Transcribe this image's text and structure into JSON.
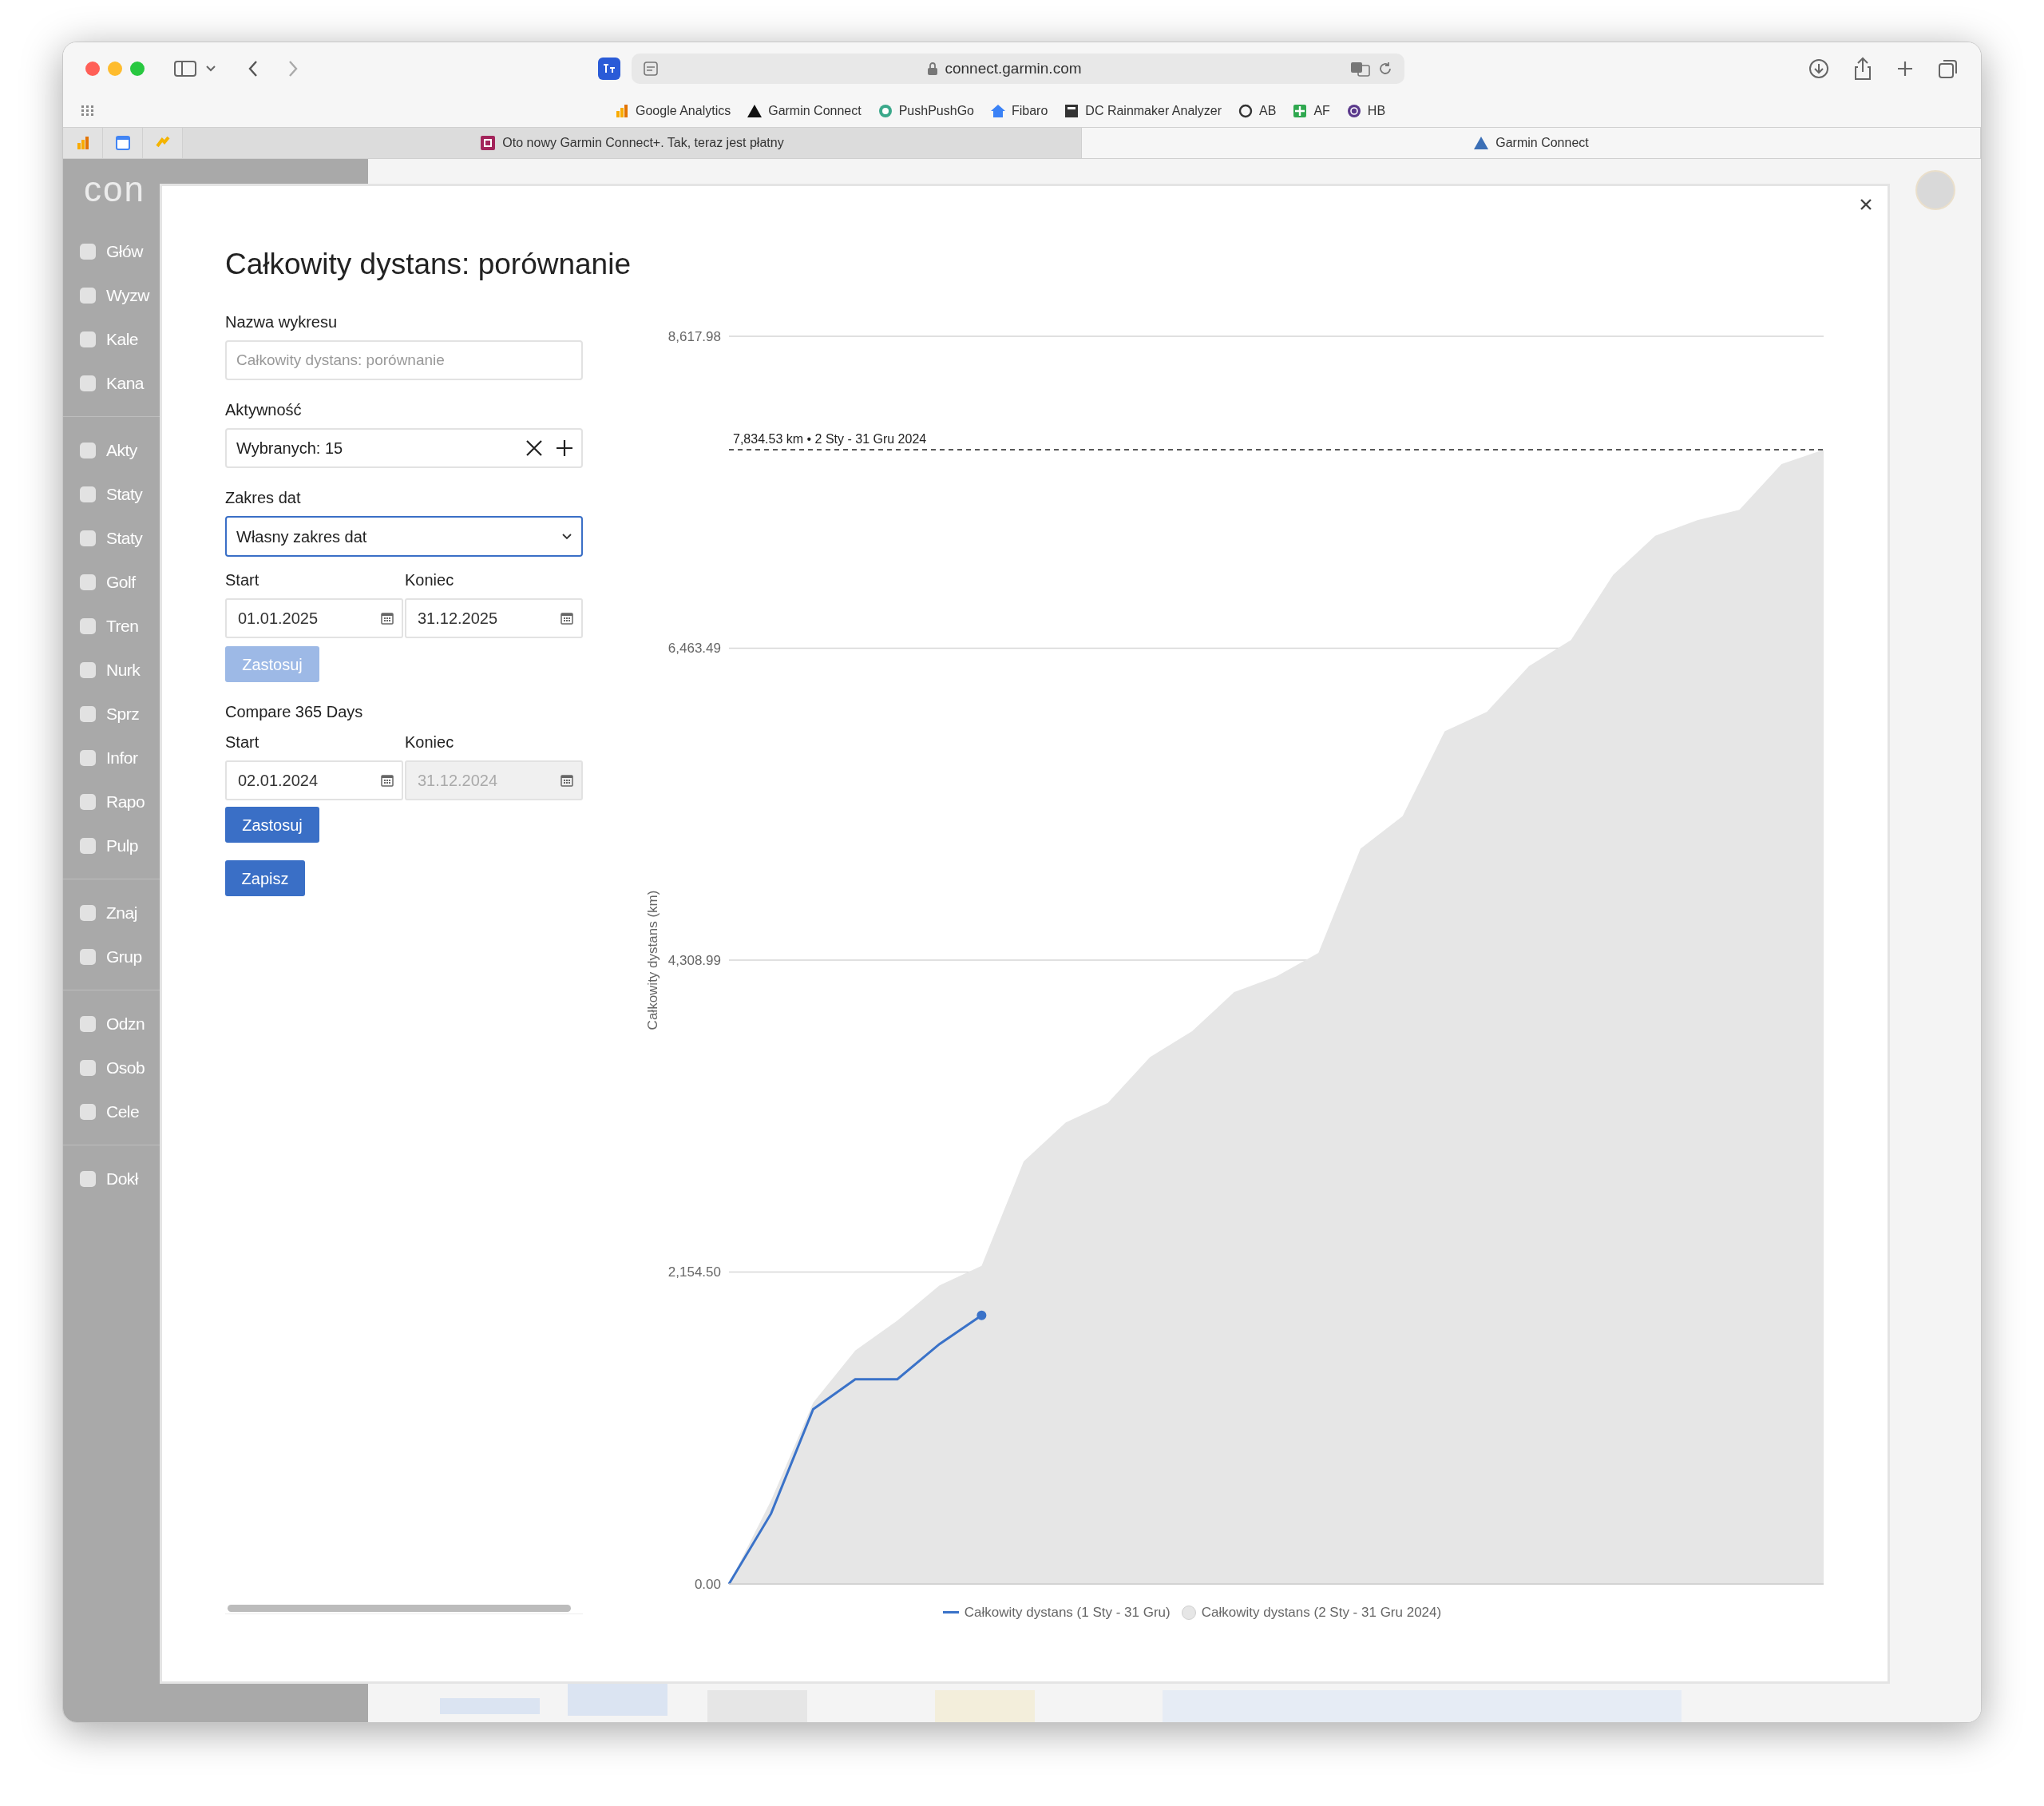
{
  "browser": {
    "url": "connect.garmin.com",
    "bookmarks": [
      {
        "label": "Google Analytics"
      },
      {
        "label": "Garmin Connect"
      },
      {
        "label": "PushPushGo"
      },
      {
        "label": "Fibaro"
      },
      {
        "label": "DC Rainmaker Analyzer"
      },
      {
        "label": "AB"
      },
      {
        "label": "AF"
      },
      {
        "label": "HB"
      }
    ],
    "tabs": [
      {
        "label": "Oto nowy Garmin Connect+. Tak, teraz jest płatny",
        "selected": false
      },
      {
        "label": "Garmin Connect",
        "selected": true
      }
    ]
  },
  "sidebar": {
    "logo": "con",
    "groups": [
      [
        "Głów",
        "Wyzw",
        "Kale",
        "Kana"
      ],
      [
        "Akty",
        "Staty",
        "Staty",
        "Golf",
        "Tren",
        "Nurk",
        "Sprz",
        "Infor",
        "Rapo",
        "Pulp"
      ],
      [
        "Znaj",
        "Grup"
      ],
      [
        "Odzn",
        "Osob",
        "Cele"
      ],
      [
        "Dokł"
      ]
    ]
  },
  "modal": {
    "title": "Całkowity dystans: porównanie",
    "name_field": {
      "label": "Nazwa wykresu",
      "placeholder": "Całkowity dystans: porównanie"
    },
    "activity_field": {
      "label": "Aktywność",
      "value": "Wybranych: 15"
    },
    "date_range": {
      "label": "Zakres dat",
      "value": "Własny zakres dat",
      "start_label": "Start",
      "start": "01.01.2025",
      "end_label": "Koniec",
      "end": "31.12.2025",
      "end_disabled": false,
      "apply": {
        "label": "Zastosuj",
        "disabled": true
      }
    },
    "compare": {
      "label": "Compare 365 Days",
      "start_label": "Start",
      "start": "02.01.2024",
      "end_label": "Koniec",
      "end": "31.12.2024",
      "end_disabled": true,
      "apply": {
        "label": "Zastosuj",
        "disabled": false
      }
    },
    "save": {
      "label": "Zapisz"
    },
    "chart_data": {
      "type": "area",
      "ylabel": "Całkowity dystans (km)",
      "ylim": [
        0,
        8617.98
      ],
      "yticks": [
        {
          "value": 0,
          "label": "0.00"
        },
        {
          "value": 2154.5,
          "label": "2,154.50"
        },
        {
          "value": 4308.99,
          "label": "4,308.99"
        },
        {
          "value": 6463.49,
          "label": "6,463.49"
        },
        {
          "value": 8617.98,
          "label": "8,617.98"
        }
      ],
      "series": [
        {
          "name": "Całkowity dystans (1 Sty - 31 Gru)",
          "type": "line",
          "color": "#3a72c8",
          "values": [
            0,
            486,
            1207,
            1414,
            1414,
            1657,
            1855,
            null,
            null,
            null,
            null,
            null,
            null,
            null,
            null,
            null,
            null,
            null,
            null,
            null,
            null,
            null,
            null,
            null,
            null,
            null,
            null
          ]
        },
        {
          "name": "Całkowity dystans (2 Sty - 31 Gru 2024)",
          "type": "area",
          "color": "#e6e6e6",
          "values": [
            0,
            576,
            1252,
            1612,
            1819,
            2062,
            2197,
            2918,
            3188,
            3323,
            3638,
            3818,
            4088,
            4196,
            4358,
            5079,
            5304,
            5889,
            6024,
            6340,
            6520,
            6970,
            7240,
            7348,
            7420,
            7735,
            7834.53
          ]
        }
      ],
      "grid": true,
      "ref_lines": [
        {
          "axis": "y",
          "value": 7834.53,
          "label": "7,834.53 km • 2 Sty - 31 Gru 2024"
        }
      ]
    }
  }
}
